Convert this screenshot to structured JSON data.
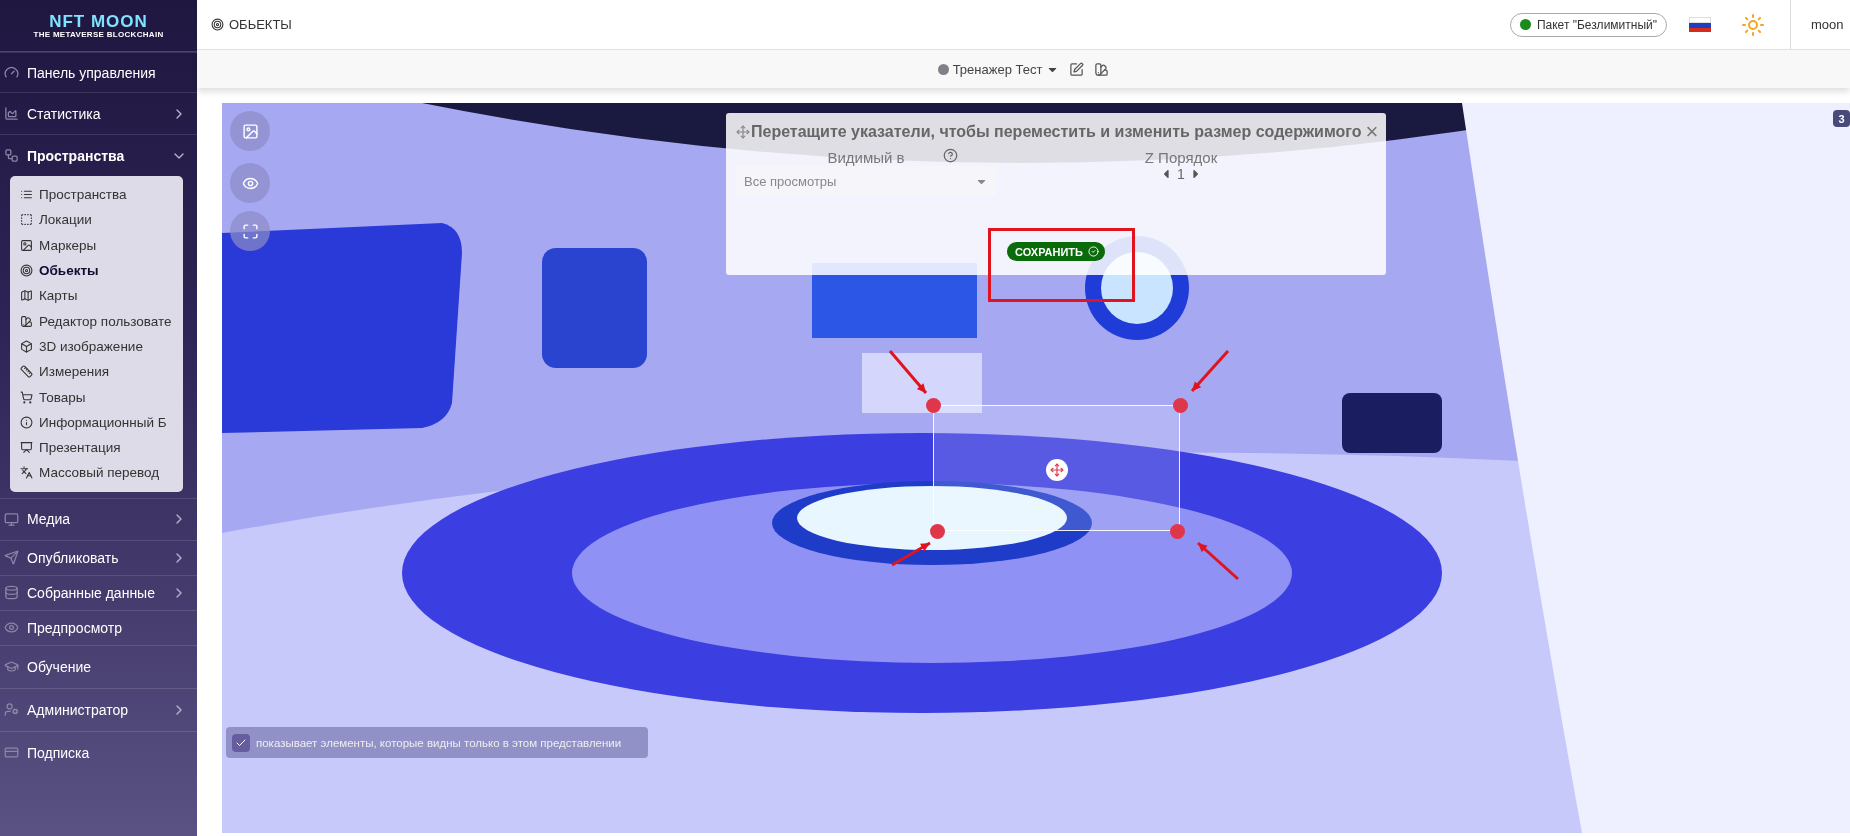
{
  "logo": {
    "title": "NFT MOON",
    "tagline": "THE METAVERSE BLOCKCHAIN"
  },
  "sidebar": {
    "items": [
      {
        "label": "Панель управления",
        "expandable": false,
        "expanded": false
      },
      {
        "label": "Статистика",
        "expandable": true,
        "expanded": false
      },
      {
        "label": "Пространства",
        "expandable": true,
        "expanded": true,
        "children": [
          {
            "label": "Пространства",
            "selected": false
          },
          {
            "label": "Локации",
            "selected": false
          },
          {
            "label": "Маркеры",
            "selected": false
          },
          {
            "label": "Обьекты",
            "selected": true
          },
          {
            "label": "Карты",
            "selected": false
          },
          {
            "label": "Редактор пользовате",
            "selected": false
          },
          {
            "label": "3D изображение",
            "selected": false
          },
          {
            "label": "Измерения",
            "selected": false
          },
          {
            "label": "Товары",
            "selected": false
          },
          {
            "label": "Информационный Б",
            "selected": false
          },
          {
            "label": "Презентация",
            "selected": false
          },
          {
            "label": "Массовый перевод",
            "selected": false
          }
        ]
      },
      {
        "label": "Медиа",
        "expandable": true,
        "expanded": false
      },
      {
        "label": "Опубликовать",
        "expandable": true,
        "expanded": false
      },
      {
        "label": "Собранные данные",
        "expandable": true,
        "expanded": false
      },
      {
        "label": "Предпросмотр",
        "expandable": false,
        "expanded": false
      },
      {
        "label": "Обучение",
        "expandable": false,
        "expanded": false
      },
      {
        "label": "Администратор",
        "expandable": true,
        "expanded": false
      },
      {
        "label": "Подписка",
        "expandable": false,
        "expanded": false
      }
    ]
  },
  "header": {
    "page_title": "ОБЬЕКТЫ",
    "plan": {
      "label": "Пакет \"Безлимитный\"",
      "color": "#1a8a1a"
    },
    "user": "moon"
  },
  "subbar": {
    "space": {
      "label": "Тренажер Тест",
      "color": "#80808c"
    }
  },
  "viewer": {
    "kind": "picture",
    "badge": "3",
    "dialog": {
      "title": "Перетащите указатели, чтобы переместить и изменить размер содержимого",
      "close": "×",
      "visible_label": "Видимый в",
      "visible_value": "Все просмотры",
      "z_label": "Z Порядок",
      "z_value": "1",
      "save": "СОХРАНИТЬ"
    },
    "checkbox": {
      "label": "показывает элементы, которые видны только в этом представлении",
      "checked": true
    }
  }
}
